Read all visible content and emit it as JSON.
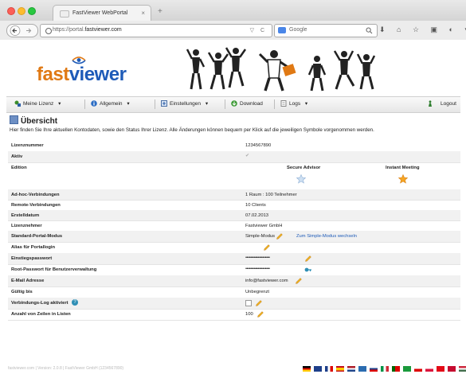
{
  "browser": {
    "tab_title": "FastViewer WebPortal",
    "tab_close": "×",
    "new_tab": "+",
    "url_prefix": "https://portal.",
    "url_domain": "fastviewer.com",
    "url_icons": "▽ C",
    "search_placeholder": "Google",
    "search_icon": "search-icon",
    "tool_glyphs": "⬇ ⌂ ☆ ▣ ◐ ▾ ≡"
  },
  "header": {
    "logo_fast": "fast",
    "logo_viewer": "viewer"
  },
  "menu": {
    "my_license": "Meine Lizenz",
    "general": "Allgemein",
    "settings": "Einstellungen",
    "download": "Download",
    "logs": "Logs",
    "logout": "Logout",
    "caret": "▾"
  },
  "page": {
    "title": "Übersicht",
    "description": "Hier finden Sie Ihre aktuellen Kontodaten, sowie den Status Ihrer Lizenz. Alle Änderungen können bequem per Klick auf die jeweiligen Symbole vorgenommen werden."
  },
  "rows": [
    {
      "label": "Lizenznummer",
      "value": "1234567890"
    },
    {
      "label": "Aktiv",
      "value": "✔"
    },
    {
      "label": "Edition",
      "value": ""
    },
    {
      "label": "Ad-hoc-Verbindungen",
      "value": "1 Raum : 100 Teilnehmer"
    },
    {
      "label": "Remote-Verbindungen",
      "value": "10 Clients"
    },
    {
      "label": "Erstelldatum",
      "value": "07.02.2013"
    },
    {
      "label": "Lizenznehmer",
      "value": "Fastviewer GmbH"
    },
    {
      "label": "Standard-Portal-Modus",
      "value": "Simple-Modus"
    },
    {
      "label": "Alias für Portallogin",
      "value": ""
    },
    {
      "label": "Einstiegspasswort",
      "value": "••••••••••••••••••••"
    },
    {
      "label": "Root-Passwort für Benutzerverwaltung",
      "value": "••••••••••••••••••••"
    },
    {
      "label": "E-Mail Adresse",
      "value": "info@fastviewer.com"
    },
    {
      "label": "Gültig bis",
      "value": "Unbegrenzt"
    },
    {
      "label": "Verbindungs-Log aktiviert",
      "value": ""
    },
    {
      "label": "Anzahl von Zeilen in Listen",
      "value": "100"
    }
  ],
  "edition": {
    "secure_advisor": "Secure Advisor",
    "instant_meeting": "Instant Meeting"
  },
  "simple_mode_link": "Zum Simple-Modus wechseln",
  "help_badge": "?",
  "footer_text": "fastviewer.com | Version: 2.0.8 | FastViewer GmbH (1234567890)",
  "colors": {
    "brand_orange": "#e07914",
    "brand_blue": "#1e5bb8",
    "link_blue": "#1e5bb8"
  }
}
